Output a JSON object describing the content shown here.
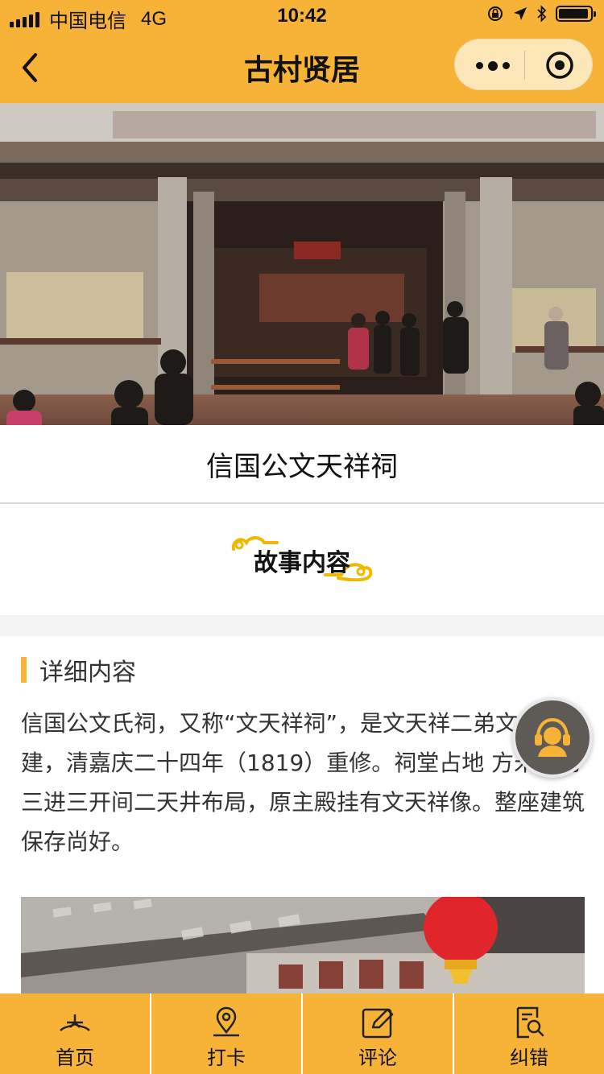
{
  "status_bar": {
    "carrier": "中国电信",
    "network": "4G",
    "time": "10:42"
  },
  "nav": {
    "title": "古村贤居",
    "back_icon": "chevron-left-icon",
    "more_icon": "more-dots-icon",
    "close_icon": "target-circle-icon"
  },
  "place": {
    "name": "信国公文天祥祠"
  },
  "story": {
    "title": "故事内容"
  },
  "detail": {
    "heading": "详细内容",
    "body": "信国公文氏祠，又称“文天祥祠”，是文天祥二弟文 裔所建，清嘉庆二十四年（1819）重修。祠堂占地 方米，为三进三开间二天井布局，原主殿挂有文天祥像。整座建筑保存尚好。"
  },
  "float_button": {
    "icon": "customer-service-icon"
  },
  "tabs": [
    {
      "label": "首页",
      "icon": "home-icon"
    },
    {
      "label": "打卡",
      "icon": "location-pin-icon"
    },
    {
      "label": "评论",
      "icon": "edit-comment-icon"
    },
    {
      "label": "纠错",
      "icon": "search-document-icon"
    }
  ],
  "colors": {
    "brand": "#F7B337",
    "capsule": "#FCE7B8",
    "accent_bar": "#F7B337",
    "float_button": "#5E5A55"
  }
}
